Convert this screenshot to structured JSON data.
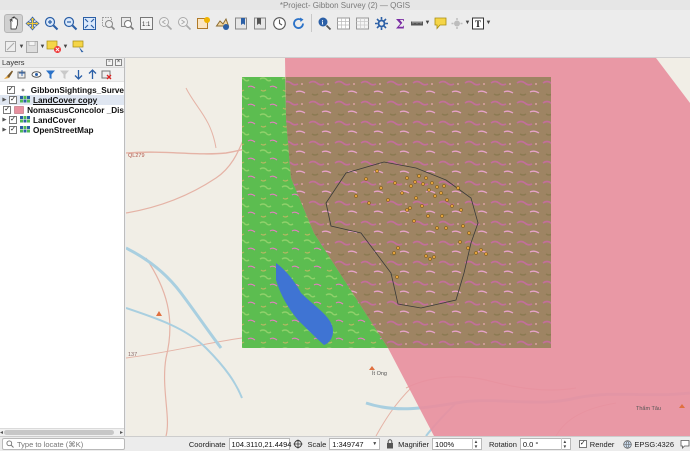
{
  "window": {
    "title": "*Project- Gibbon Survey (2) — QGIS"
  },
  "toolbar_primary": {
    "icons": [
      "pan-icon",
      "pan-to-selection-icon",
      "zoom-in-icon",
      "zoom-out-icon",
      "zoom-full-icon",
      "zoom-to-selection-icon",
      "zoom-to-layer-icon",
      "zoom-native-icon",
      "zoom-last-icon",
      "zoom-next-icon",
      "new-map-view-icon",
      "new-3d-map-icon",
      "new-bookmark-icon",
      "show-bookmarks-icon",
      "temporal-controller-icon",
      "refresh-icon",
      "identify-icon",
      "select-features-icon",
      "deselect-icon",
      "toolbox-icon",
      "statistics-icon",
      "measure-icon",
      "map-tips-icon",
      "annotation-icon",
      "text-annotation-icon"
    ]
  },
  "toolbar_secondary": {
    "icons": [
      "digitizing-icon",
      "save-edits-icon",
      "add-feature-icon",
      "label-icon"
    ]
  },
  "layers_panel": {
    "title": "Layers",
    "tools": [
      "open-styling-icon",
      "add-group-icon",
      "manage-visibility-icon",
      "filter-legend-icon",
      "filter-expression-icon",
      "expand-all-icon",
      "collapse-all-icon",
      "remove-layer-icon"
    ],
    "layers": [
      {
        "name": "GibbonSightings_Surve",
        "checked": true,
        "expanded": false,
        "icon": "point-layer-icon",
        "active": false
      },
      {
        "name": "LandCover copy",
        "checked": true,
        "expanded": false,
        "icon": "raster-layer-icon",
        "active": true
      },
      {
        "name": "NomascusConcolor _Dis",
        "checked": true,
        "expanded": false,
        "icon": "polygon-layer-icon",
        "active": false
      },
      {
        "name": "LandCover",
        "checked": true,
        "expanded": false,
        "icon": "raster-layer-icon",
        "active": false
      },
      {
        "name": "OpenStreetMap",
        "checked": true,
        "expanded": false,
        "icon": "tile-layer-icon",
        "active": false
      }
    ]
  },
  "map_labels": {
    "road_270": "QL279",
    "road_137": "137",
    "town": "Ít Ong",
    "place_right": "Thẩm Tâu"
  },
  "status_bar": {
    "locator_placeholder": "Type to locate (⌘K)",
    "coordinate_label": "Coordinate",
    "coordinate_value": "104.3110,21.4494",
    "scale_label": "Scale",
    "scale_value": "1:349747",
    "magnifier_label": "Magnifier",
    "magnifier_value": "100%",
    "rotation_label": "Rotation",
    "rotation_value": "0.0 °",
    "render_label": "Render",
    "render_checked": true,
    "crs": "EPSG:4326"
  },
  "colors": {
    "landcover_forest": "#4fba55",
    "range_polygon": "#e8909f",
    "sightings": "#e2a23a",
    "water": "#3f74d3"
  }
}
